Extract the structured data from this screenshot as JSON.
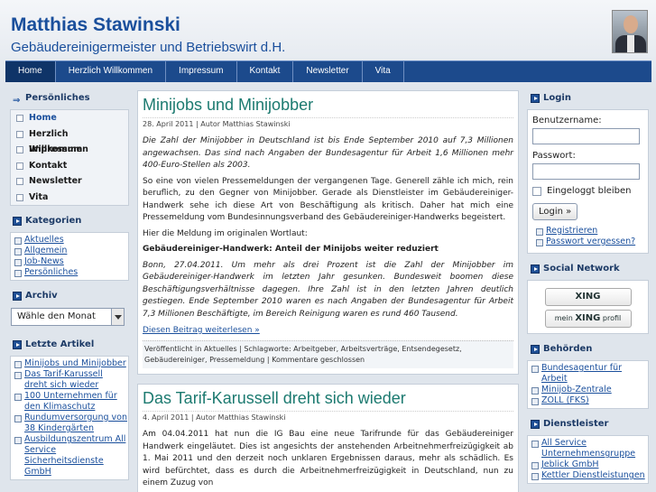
{
  "site": {
    "title": "Matthias Stawinski",
    "description": "Gebäudereinigermeister und Betriebswirt d.H."
  },
  "nav": [
    "Home",
    "Herzlich Willkommen",
    "Impressum",
    "Kontakt",
    "Newsletter",
    "Vita"
  ],
  "left": {
    "personal_title": "Persönliches",
    "personal_items": [
      "Home",
      "Herzlich Willkommen",
      "Impressum",
      "Kontakt",
      "Newsletter",
      "Vita"
    ],
    "categories_title": "Kategorien",
    "categories": [
      "Aktuelles",
      "Allgemein",
      "Job-News",
      "Persönliches"
    ],
    "archive_title": "Archiv",
    "archive_select": "Wähle den Monat",
    "recent_title": "Letzte Artikel",
    "recent": [
      "Minijobs und Minijobber",
      "Das Tarif-Karussell dreht sich wieder",
      "100 Unternehmen für den Klimaschutz",
      "Rundumversorgung von 38 Kindergärten",
      "Ausbildungszentrum All Service Sicherheitsdienste GmbH"
    ]
  },
  "posts": [
    {
      "title": "Minijobs und Minijobber",
      "meta": "28. April 2011 | Autor Matthias Stawinski",
      "p1": "Die Zahl der Minijobber in Deutschland ist bis Ende September 2010 auf 7,3 Millionen angewachsen. Das sind nach Angaben der Bundesagentur für Arbeit 1,6 Millionen mehr 400-Euro-Stellen als 2003.",
      "p2": "So eine von vielen Pressemeldungen der vergangenen Tage. Generell zähle ich mich, rein beruflich, zu den Gegner von Minijobber. Gerade als Dienstleister im Gebäudereiniger-Handwerk sehe ich diese Art von Beschäftigung als kritisch. Daher hat mich eine Pressemeldung vom Bundesinnungsverband des Gebäudereiniger-Handwerks begeistert.",
      "p3": "Hier die Meldung im originalen Wortlaut:",
      "p4": "Gebäudereiniger-Handwerk: Anteil der Minijobs weiter reduziert",
      "p5": "Bonn, 27.04.2011. Um mehr als drei Prozent ist die Zahl der Minijobber im Gebäudereiniger-Handwerk im letzten Jahr gesunken. Bundesweit boomen diese Beschäftigungsverhältnisse dagegen. Ihre Zahl ist in den letzten Jahren deutlich gestiegen. Ende September 2010 waren es nach Angaben der Bundesagentur für Arbeit 7,3 Millionen Beschäftigte, im Bereich Reinigung waren es rund 460 Tausend.",
      "more": "Diesen Beitrag weiterlesen »",
      "footer": "Veröffentlicht in Aktuelles | Schlagworte: Arbeitgeber, Arbeitsverträge, Entsendegesetz, Gebäudereiniger, Pressemeldung | Kommentare geschlossen"
    },
    {
      "title": "Das Tarif-Karussell dreht sich wieder",
      "meta": "4. April 2011 | Autor Matthias Stawinski",
      "p1": "Am 04.04.2011 hat nun die IG Bau eine neue Tarifrunde für das Gebäudereiniger Handwerk eingeläutet. Dies ist angesichts der anstehenden Arbeitnehmerfreizügigkeit ab 1. Mai 2011 und den derzeit noch unklaren Ergebnissen daraus, mehr als schädlich. Es wird befürchtet, dass es durch die Arbeitnehmerfreizügigkeit in Deutschland, nun zu einem Zuzug von"
    }
  ],
  "right": {
    "login_title": "Login",
    "username_label": "Benutzername:",
    "password_label": "Passwort:",
    "remember": "Eingeloggt bleiben",
    "login_button": "Login »",
    "register": "Registrieren",
    "forgot": "Passwort vergessen?",
    "social_title": "Social Network",
    "xing1": "XING",
    "xing2_pre": "mein",
    "xing2_brand": "XING",
    "xing2_post": "profil",
    "auth_title": "Behörden",
    "auth": [
      "Bundesagentur für Arbeit",
      "Minijob-Zentrale",
      "ZOLL (FKS)"
    ],
    "serv_title": "Dienstleister",
    "serv": [
      "All Service Unternehmensgruppe",
      "Jeblick GmbH",
      "Kettler Dienstleistungen"
    ]
  }
}
